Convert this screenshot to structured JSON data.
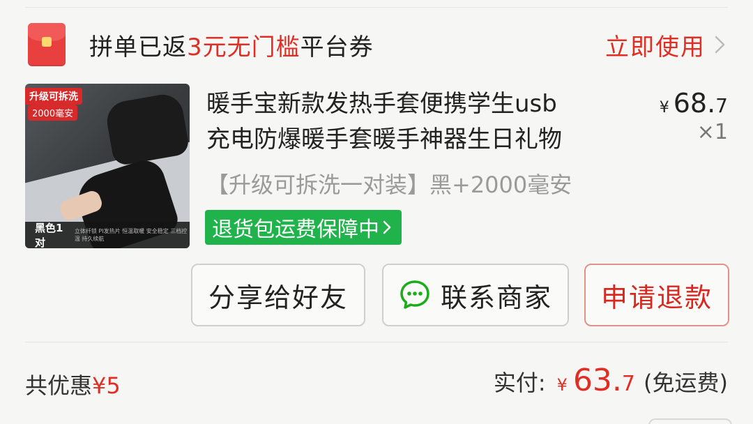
{
  "coupon": {
    "prefix": "拼单已返",
    "highlight": "3元无门槛",
    "suffix": "平台券",
    "action": "立即使用",
    "accent": "#e02e24"
  },
  "product": {
    "thumb_tag_1": "升级可拆洗",
    "thumb_tag_2": "2000毫安",
    "thumb_footer_main": "黑色1对",
    "thumb_footer_sub": "立体纤锁 PI发热片 恒温取暖 安全稳定 三档控温 持久续航",
    "title_line1": "暖手宝新款发热手套便携学生usb",
    "title_line2": "充电防爆暖手套暖手神器生日礼物",
    "price_currency": "¥",
    "price_int": "68.",
    "price_dec": "7",
    "quantity": "×1",
    "spec": "【升级可拆洗一对装】黑+2000毫安",
    "guarantee": "退货包运费保障中"
  },
  "actions": {
    "share": "分享给好友",
    "contact": "联系商家",
    "refund": "申请退款"
  },
  "summary": {
    "discount_label": "共优惠",
    "discount_amount": "¥5",
    "paid_label": "实付:",
    "paid_currency": "¥",
    "paid_int": "63.",
    "paid_dec": "7",
    "shipping_note": "(免运费)"
  },
  "colors": {
    "brand_red": "#e02e24",
    "guarantee_green": "#20b24b",
    "chat_green": "#1aad19"
  },
  "icons": [
    "red-envelope-icon",
    "chevron-right-icon",
    "chat-bubble-icon"
  ]
}
